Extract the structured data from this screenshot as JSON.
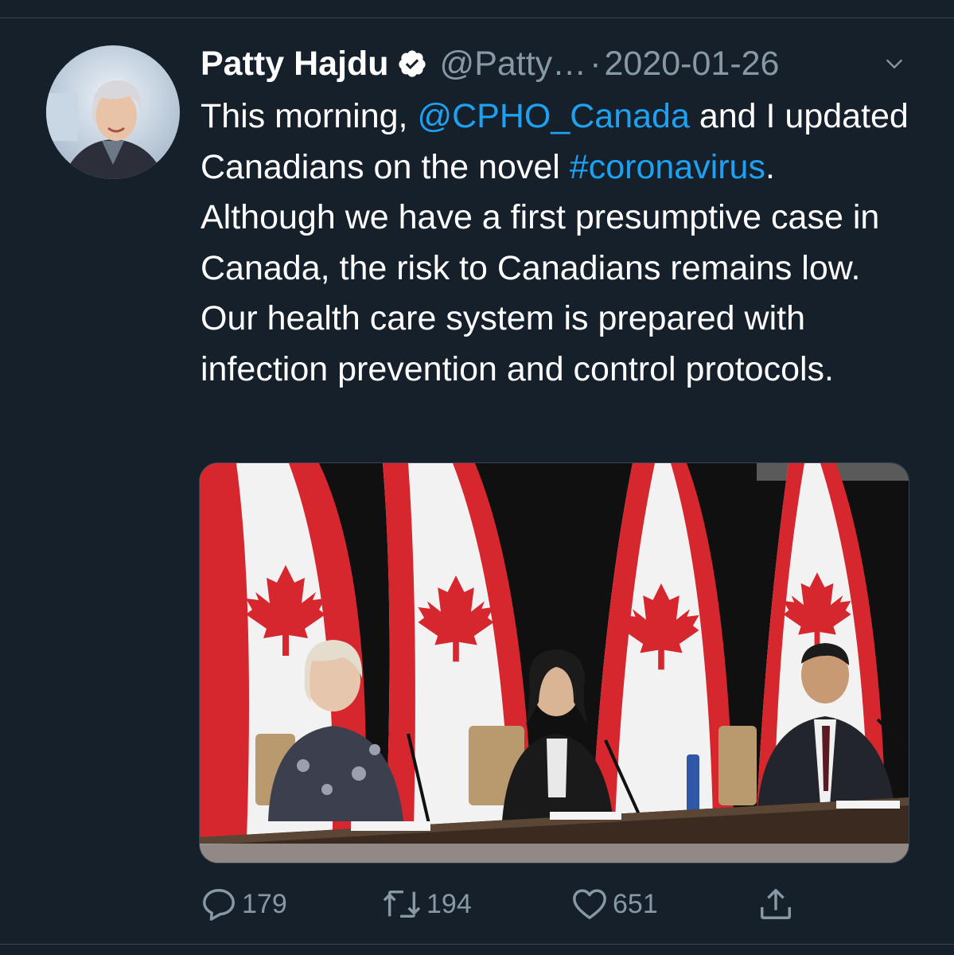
{
  "tweet": {
    "author": {
      "display_name": "Patty Hajdu",
      "handle": "@Patty…",
      "verified": true
    },
    "separator": "·",
    "date": "2020-01-26",
    "text": {
      "part1": "This morning, ",
      "mention": "@CPHO_Canada",
      "part2": " and I updated Canadians on the novel ",
      "hashtag": "#coronavirus",
      "part3": ". Although we have a first presumptive case in Canada, the risk to Canadians remains low. Our health care system is prepared with infection prevention and control protocols."
    },
    "actions": {
      "replies": "179",
      "retweets": "194",
      "likes": "651"
    }
  },
  "colors": {
    "background": "#15202b",
    "link": "#1da1f2",
    "secondary_text": "#8899a6",
    "flag_red": "#d6262e"
  },
  "icons": [
    "verified-badge-icon",
    "chevron-down-icon",
    "reply-icon",
    "retweet-icon",
    "like-icon",
    "share-icon"
  ]
}
